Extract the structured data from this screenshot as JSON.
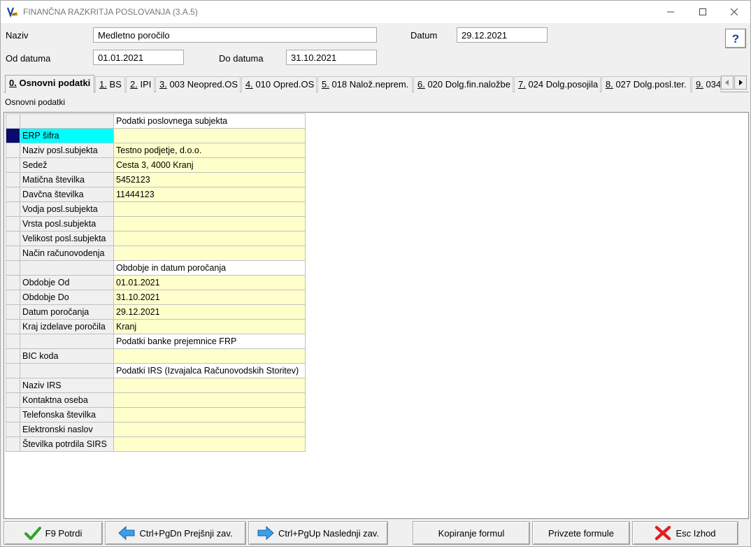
{
  "window": {
    "title": "FINANČNA RAZKRITJA POSLOVANJA  (3.A.5)"
  },
  "form": {
    "naziv_label": "Naziv",
    "naziv_value": "Medletno poročilo",
    "datum_label": "Datum",
    "datum_value": "29.12.2021",
    "od_label": "Od datuma",
    "od_value": "01.01.2021",
    "do_label": "Do datuma",
    "do_value": "31.10.2021",
    "help_label": "?"
  },
  "tabs": [
    {
      "key": "0.",
      "label": " Osnovni podatki"
    },
    {
      "key": "1.",
      "label": " BS"
    },
    {
      "key": "2.",
      "label": " IPI"
    },
    {
      "key": "3.",
      "label": " 003 Neopred.OS"
    },
    {
      "key": "4.",
      "label": " 010 Opred.OS"
    },
    {
      "key": "5.",
      "label": " 018 Nalož.neprem."
    },
    {
      "key": "6.",
      "label": " 020 Dolg.fin.naložbe"
    },
    {
      "key": "7.",
      "label": " 024 Dolg.posojila"
    },
    {
      "key": "8.",
      "label": " 027 Dolg.posl.ter."
    },
    {
      "key": "9.",
      "label": " 034"
    }
  ],
  "section_caption": "Osnovni podatki",
  "grid": {
    "header": "Podatki poslovnega subjekta",
    "rows": [
      {
        "name": "ERP šifra",
        "value": ""
      },
      {
        "name": "Naziv posl.subjekta",
        "value": "Testno podjetje, d.o.o."
      },
      {
        "name": "Sedež",
        "value": "Cesta 3, 4000 Kranj"
      },
      {
        "name": "Matična številka",
        "value": "5452123"
      },
      {
        "name": "Davčna številka",
        "value": "11444123"
      },
      {
        "name": "Vodja posl.subjekta",
        "value": ""
      },
      {
        "name": "Vrsta posl.subjekta",
        "value": ""
      },
      {
        "name": "Velikost posl.subjekta",
        "value": ""
      },
      {
        "name": "Način računovodenja",
        "value": ""
      },
      {
        "name": "",
        "value": "Obdobje in datum poročanja",
        "section": true
      },
      {
        "name": "Obdobje Od",
        "value": "01.01.2021"
      },
      {
        "name": "Obdobje Do",
        "value": "31.10.2021"
      },
      {
        "name": "Datum poročanja",
        "value": "29.12.2021"
      },
      {
        "name": "Kraj izdelave poročila",
        "value": "Kranj"
      },
      {
        "name": "",
        "value": "Podatki banke prejemnice FRP",
        "section": true
      },
      {
        "name": "BIC koda",
        "value": ""
      },
      {
        "name": "",
        "value": "Podatki IRS (Izvajalca Računovodskih Storitev)",
        "section": true
      },
      {
        "name": "Naziv IRS",
        "value": ""
      },
      {
        "name": "Kontaktna oseba",
        "value": ""
      },
      {
        "name": "Telefonska številka",
        "value": ""
      },
      {
        "name": "Elektronski naslov",
        "value": ""
      },
      {
        "name": "Številka potrdila SIRS",
        "value": ""
      }
    ]
  },
  "buttons": {
    "confirm": "F9 Potrdi",
    "prev": "Ctrl+PgDn Prejšnji zav.",
    "next": "Ctrl+PgUp Naslednji zav.",
    "copy_formulas": "Kopiranje formul",
    "default_formulas": "Privzete formule",
    "exit": "Esc Izhod"
  },
  "colors": {
    "selected_indicator": "#0a0a6e",
    "selected_cell": "#00ffff",
    "value_cell": "#ffffcc"
  }
}
